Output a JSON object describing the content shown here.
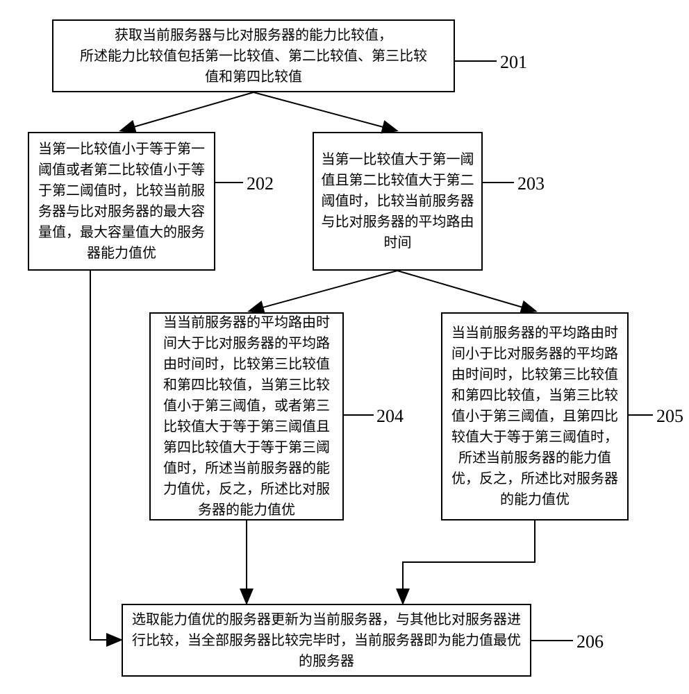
{
  "flowchart": {
    "nodes": {
      "201": {
        "text": "获取当前服务器与比对服务器的能力比较值，\n所述能力比较值包括第一比较值、第二比较值、第三比较\n值和第四比较值",
        "label": "201"
      },
      "202": {
        "text": "当第一比较值小于等于第一阈值或者第二比较值小于等于第二阈值时，比较当前服务器与比对服务器的最大容量值，最大容量值大的服务器能力值优",
        "label": "202"
      },
      "203": {
        "text": "当第一比较值大于第一阈值且第二比较值大于第二阈值时，比较当前服务器与比对服务器的平均路由时间",
        "label": "203"
      },
      "204": {
        "text": "当当前服务器的平均路由时间大于比对服务器的平均路由时间时，比较第三比较值和第四比较值，当第三比较值小于第三阈值，或者第三比较值大于等于第三阈值且第四比较值大于等于第三阈值时，所述当前服务器的能力值优，反之，所述比对服务器的能力值优",
        "label": "204"
      },
      "205": {
        "text": "当当前服务器的平均路由时间小于比对服务器的平均路由时间时，比较第三比较值和第四比较值，当第三比较值小于第三阈值，且第四比较值大于等于第三阈值时，所述当前服务器的能力值优，反之，所述比对服务器的能力值优",
        "label": "205"
      },
      "206": {
        "text": "选取能力值优的服务器更新为当前服务器，与其他比对服务器进行比较，当全部服务器比较完毕时，当前服务器即为能力值最优的服务器",
        "label": "206"
      }
    },
    "edges": [
      {
        "from": "201",
        "to": "202"
      },
      {
        "from": "201",
        "to": "203"
      },
      {
        "from": "203",
        "to": "204"
      },
      {
        "from": "203",
        "to": "205"
      },
      {
        "from": "202",
        "to": "206"
      },
      {
        "from": "204",
        "to": "206"
      },
      {
        "from": "205",
        "to": "206"
      }
    ]
  }
}
